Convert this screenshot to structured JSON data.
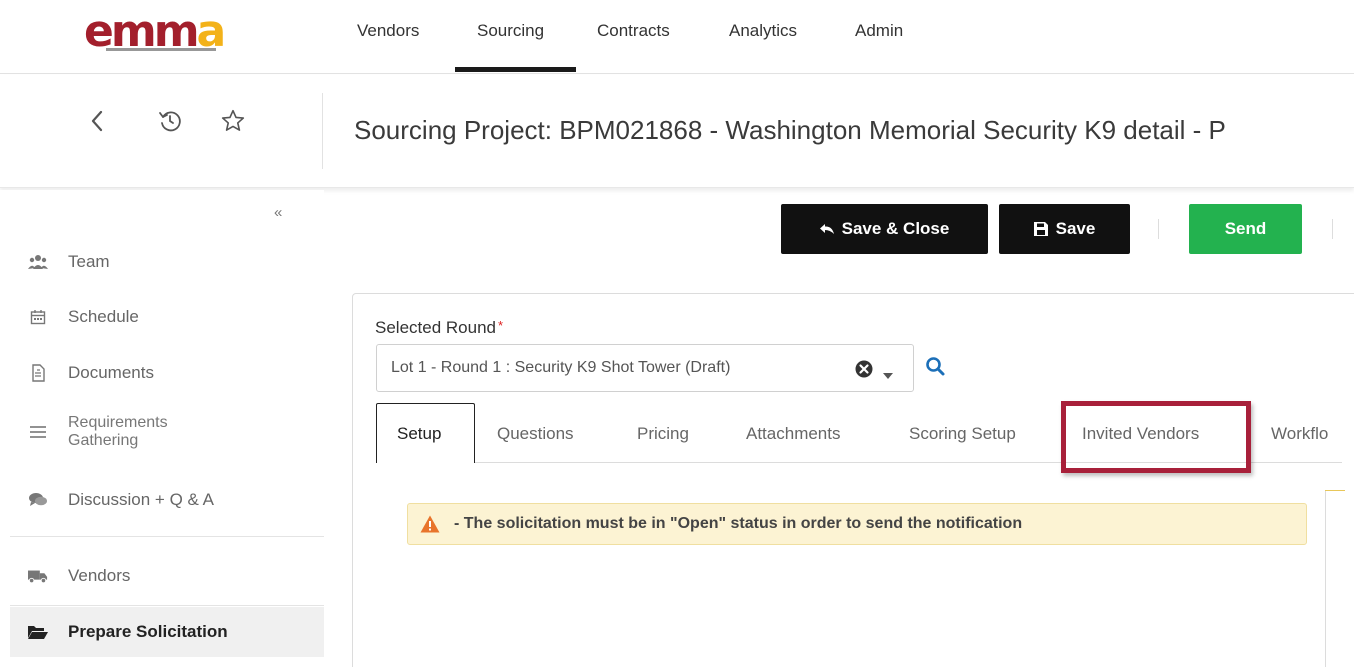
{
  "app": {
    "logo_text": "emm",
    "logo_accent": "a",
    "brand_colors": {
      "red": "#a31f2c",
      "gold": "#f3b219"
    }
  },
  "topnav": {
    "items": [
      "Vendors",
      "Sourcing",
      "Contracts",
      "Analytics",
      "Admin"
    ],
    "active": "Sourcing"
  },
  "header": {
    "title": "Sourcing Project: BPM021868 - Washington Memorial Security K9 detail - P",
    "icons": [
      "back-icon",
      "history-icon",
      "favorite-star-icon"
    ]
  },
  "sidebar": {
    "collapse_label": "«",
    "items": [
      {
        "label": "Team",
        "icon": "team-icon"
      },
      {
        "label": "Schedule",
        "icon": "calendar-icon"
      },
      {
        "label": "Documents",
        "icon": "document-icon"
      },
      {
        "label": "Requirements Gathering",
        "icon": "list-icon"
      },
      {
        "label": "Discussion + Q & A",
        "icon": "comments-icon"
      },
      {
        "label": "Vendors",
        "icon": "truck-icon"
      },
      {
        "label": "Prepare Solicitation",
        "icon": "folder-open-icon"
      }
    ],
    "active": "Prepare Solicitation"
  },
  "actions": {
    "save_close": "Save & Close",
    "save": "Save",
    "send": "Send",
    "send_color": "#23b24f"
  },
  "round": {
    "label": "Selected Round",
    "required_mark": "*",
    "value": "Lot 1 - Round 1 : Security K9 Shot Tower (Draft)"
  },
  "tabs": {
    "items": [
      "Setup",
      "Questions",
      "Pricing",
      "Attachments",
      "Scoring Setup",
      "Invited Vendors",
      "Workflo"
    ],
    "active": "Setup",
    "highlighted": "Invited Vendors",
    "highlight_color": "#a8203a"
  },
  "alert": {
    "message": "- The solicitation must be in \"Open\" status in order to send the notification"
  }
}
